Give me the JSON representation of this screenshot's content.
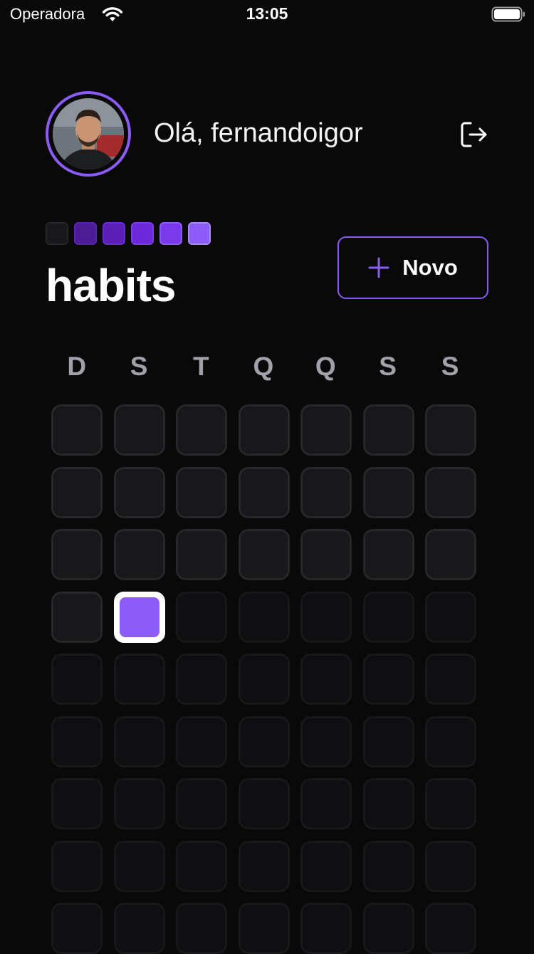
{
  "status_bar": {
    "carrier": "Operadora",
    "time": "13:05",
    "wifi_icon": "wifi-icon",
    "battery_icon": "battery-full-icon"
  },
  "header": {
    "greeting": "Olá, fernandoigor",
    "avatar": "user-avatar",
    "logout_icon": "logout-icon"
  },
  "logo": {
    "word": "habits",
    "squares": [
      {
        "fill": "#18181b",
        "border": "#27272a"
      },
      {
        "fill": "#4c1d95",
        "border": "#5b21b6"
      },
      {
        "fill": "#5b21b6",
        "border": "#6d28d9"
      },
      {
        "fill": "#6d28d9",
        "border": "#7c3aed"
      },
      {
        "fill": "#7c3aed",
        "border": "#8b5cf6"
      },
      {
        "fill": "#8b5cf6",
        "border": "#a78bfa"
      }
    ]
  },
  "new_button": {
    "label": "Novo",
    "icon": "plus-icon"
  },
  "weekdays": [
    "D",
    "S",
    "T",
    "Q",
    "Q",
    "S",
    "S"
  ],
  "summary": {
    "rows_visible": 9,
    "columns": 7,
    "past_days": 22,
    "today_index": 22
  },
  "colors": {
    "accent": "#8b5cf6",
    "background": "#09090a",
    "past_day": "#18181b",
    "future_day": "#0f0f11"
  }
}
